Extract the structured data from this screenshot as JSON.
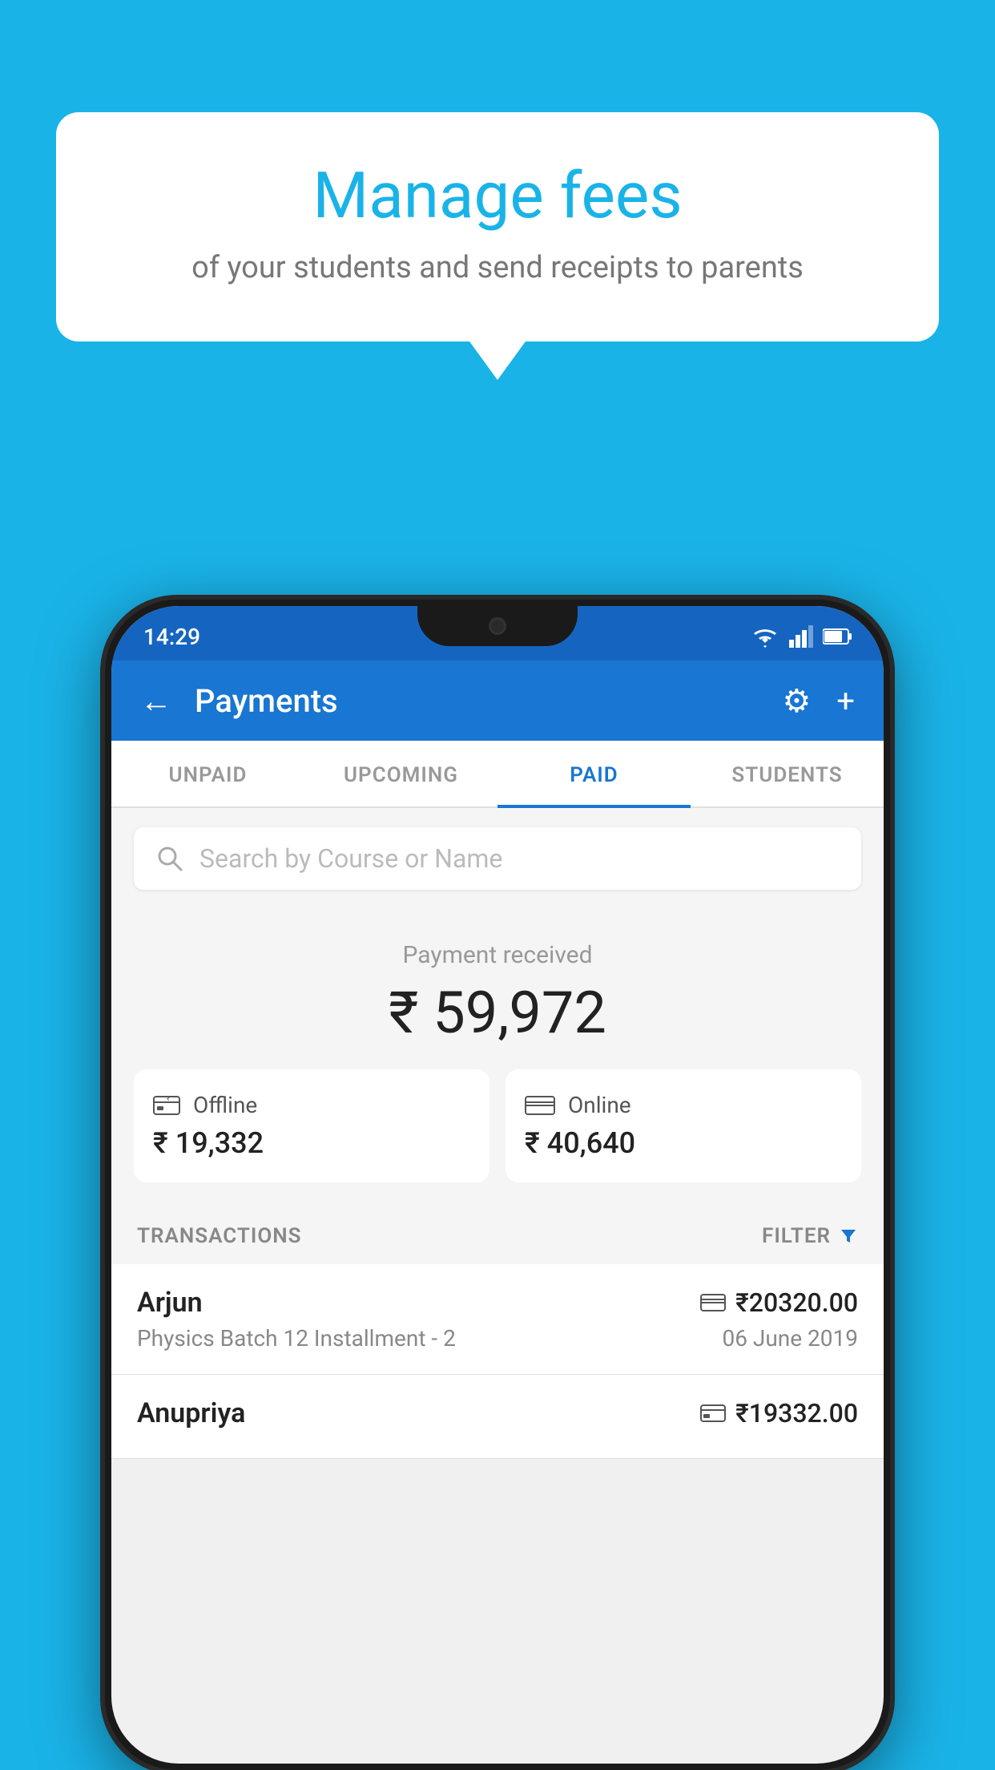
{
  "background_color": "#1ab3e8",
  "speech_bubble": {
    "title": "Manage fees",
    "subtitle": "of your students and send receipts to parents"
  },
  "status_bar": {
    "time": "14:29",
    "wifi": "▲",
    "signal": "▲",
    "battery": "▉"
  },
  "app_bar": {
    "title": "Payments",
    "back_label": "←",
    "gear_label": "⚙",
    "plus_label": "+"
  },
  "tabs": [
    {
      "label": "UNPAID",
      "active": false
    },
    {
      "label": "UPCOMING",
      "active": false
    },
    {
      "label": "PAID",
      "active": true
    },
    {
      "label": "STUDENTS",
      "active": false
    }
  ],
  "search": {
    "placeholder": "Search by Course or Name"
  },
  "payment_received": {
    "label": "Payment received",
    "amount": "₹ 59,972",
    "offline": {
      "label": "Offline",
      "amount": "₹ 19,332"
    },
    "online": {
      "label": "Online",
      "amount": "₹ 40,640"
    }
  },
  "transactions": {
    "header": "TRANSACTIONS",
    "filter": "FILTER",
    "items": [
      {
        "name": "Arjun",
        "course": "Physics Batch 12 Installment - 2",
        "amount": "₹20320.00",
        "date": "06 June 2019",
        "payment_type": "online"
      },
      {
        "name": "Anupriya",
        "course": "",
        "amount": "₹19332.00",
        "date": "",
        "payment_type": "offline"
      }
    ]
  }
}
